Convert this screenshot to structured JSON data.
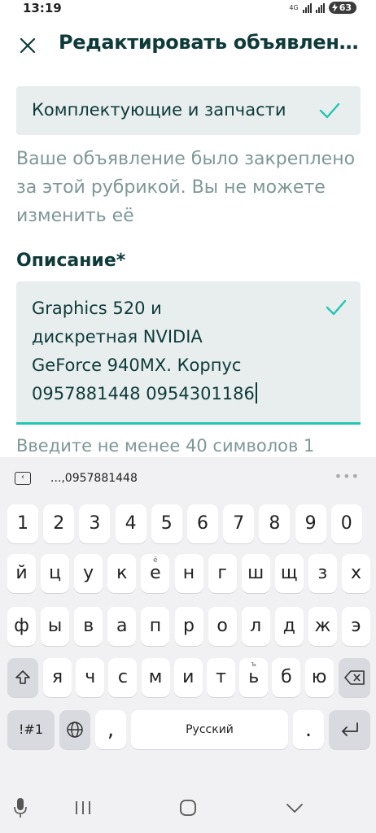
{
  "status": {
    "time": "13:19",
    "network": "4G",
    "battery": "63"
  },
  "header": {
    "title": "Редактировать объявление"
  },
  "category": {
    "value": "Комплектующие и запчасти"
  },
  "category_note": "Ваше объявление было закреплено за этой рубрикой. Вы не можете изменить её",
  "description": {
    "label": "Описание*",
    "value": "Graphics 520 и\nдискретная NVIDIA\nGeForce 940MX. Корпус\n0957881448 0954301186",
    "hint": "Введите не менее 40 символов 1"
  },
  "keyboard": {
    "suggestion": "...,0957881448",
    "row_digits": [
      "1",
      "2",
      "3",
      "4",
      "5",
      "6",
      "7",
      "8",
      "9",
      "0"
    ],
    "row1": [
      "й",
      "ц",
      "у",
      "к",
      "е",
      "н",
      "г",
      "ш",
      "щ",
      "з",
      "х"
    ],
    "row1_sup": {
      "е": "ё"
    },
    "row2": [
      "ф",
      "ы",
      "в",
      "а",
      "п",
      "р",
      "о",
      "л",
      "д",
      "ж",
      "э"
    ],
    "row3": [
      "я",
      "ч",
      "с",
      "м",
      "и",
      "т",
      "ь",
      "б",
      "ю"
    ],
    "row3_sup": {
      "ь": "ъ"
    },
    "symbols_label": "!#1",
    "comma": ",",
    "space_label": "Русский",
    "period": "."
  },
  "colors": {
    "accent": "#23c6b2",
    "text_dark": "#0f3a3a",
    "text_muted": "#7f9797",
    "field_bg": "#e8eeee"
  }
}
